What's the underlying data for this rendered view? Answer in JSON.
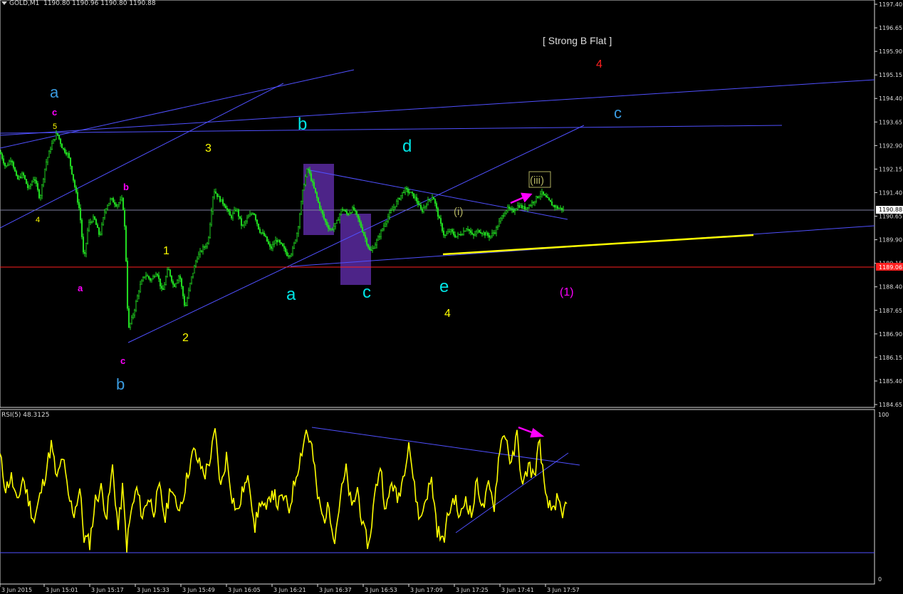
{
  "header": {
    "symbol": "GOLD,M1",
    "ohlc": "1190.80 1190.96 1190.80 1190.88"
  },
  "rsi_header": {
    "label": "RSI(5) 48.3125"
  },
  "colors": {
    "background": "#000000",
    "candle": "#22dd22",
    "trendline": "#5050ff",
    "red_line": "#ff2020",
    "yellow": "#ffff00",
    "cyan": "#00e5e5",
    "blue_label": "#3a9be0",
    "magenta": "#ff00ff",
    "purple_box": "#5a2aa0"
  },
  "chart_data": [
    {
      "type": "line",
      "name": "price",
      "title": "",
      "y_axis_ticks": [
        "1197.40",
        "1196.65",
        "1195.90",
        "1195.15",
        "1194.40",
        "1193.65",
        "1192.90",
        "1192.15",
        "1191.40",
        "1190.65",
        "1189.90",
        "1189.15",
        "1188.40",
        "1187.65",
        "1186.90",
        "1186.15",
        "1185.40",
        "1184.65"
      ],
      "ylim": [
        1184.65,
        1197.4
      ],
      "current_price": "1190.88",
      "red_level": "1189.06",
      "x_ticks": [
        "3 Jun 2015",
        "3 Jun 15:01",
        "3 Jun 15:17",
        "3 Jun 15:33",
        "3 Jun 15:49",
        "3 Jun 16:05",
        "3 Jun 16:21",
        "3 Jun 16:37",
        "3 Jun 16:53",
        "3 Jun 17:09",
        "3 Jun 17:25",
        "3 Jun 17:41",
        "3 Jun 17:57"
      ],
      "anchors": [
        [
          0,
          1192.7
        ],
        [
          8,
          1192.2
        ],
        [
          16,
          1192.5
        ],
        [
          24,
          1191.8
        ],
        [
          32,
          1192.0
        ],
        [
          40,
          1191.5
        ],
        [
          48,
          1191.9
        ],
        [
          56,
          1191.2
        ],
        [
          64,
          1192.3
        ],
        [
          72,
          1192.9
        ],
        [
          80,
          1193.3
        ],
        [
          88,
          1192.8
        ],
        [
          96,
          1192.6
        ],
        [
          104,
          1191.7
        ],
        [
          112,
          1190.8
        ],
        [
          118,
          1189.2
        ],
        [
          124,
          1190.4
        ],
        [
          132,
          1190.6
        ],
        [
          140,
          1190.0
        ],
        [
          148,
          1190.9
        ],
        [
          156,
          1191.2
        ],
        [
          164,
          1191.0
        ],
        [
          172,
          1191.2
        ],
        [
          176,
          1190.0
        ],
        [
          180,
          1187.0
        ],
        [
          188,
          1187.6
        ],
        [
          196,
          1188.4
        ],
        [
          204,
          1188.8
        ],
        [
          212,
          1188.6
        ],
        [
          220,
          1188.9
        ],
        [
          228,
          1188.2
        ],
        [
          236,
          1189.0
        ],
        [
          244,
          1188.4
        ],
        [
          252,
          1188.8
        ],
        [
          260,
          1187.7
        ],
        [
          268,
          1188.6
        ],
        [
          276,
          1189.3
        ],
        [
          284,
          1189.6
        ],
        [
          292,
          1189.8
        ],
        [
          300,
          1191.5
        ],
        [
          308,
          1191.2
        ],
        [
          316,
          1191.0
        ],
        [
          324,
          1190.6
        ],
        [
          332,
          1190.9
        ],
        [
          340,
          1190.3
        ],
        [
          348,
          1190.6
        ],
        [
          356,
          1190.8
        ],
        [
          364,
          1190.2
        ],
        [
          372,
          1190.0
        ],
        [
          380,
          1189.6
        ],
        [
          388,
          1189.9
        ],
        [
          396,
          1189.7
        ],
        [
          404,
          1189.4
        ],
        [
          410,
          1189.5
        ],
        [
          418,
          1190.2
        ],
        [
          426,
          1191.6
        ],
        [
          432,
          1192.2
        ],
        [
          440,
          1191.6
        ],
        [
          448,
          1191.0
        ],
        [
          456,
          1190.5
        ],
        [
          464,
          1190.2
        ],
        [
          472,
          1190.4
        ],
        [
          480,
          1190.9
        ],
        [
          488,
          1190.7
        ],
        [
          496,
          1190.9
        ],
        [
          504,
          1190.5
        ],
        [
          512,
          1190.0
        ],
        [
          520,
          1189.5
        ],
        [
          528,
          1189.8
        ],
        [
          536,
          1190.2
        ],
        [
          544,
          1190.6
        ],
        [
          552,
          1190.9
        ],
        [
          560,
          1191.2
        ],
        [
          568,
          1191.5
        ],
        [
          576,
          1191.4
        ],
        [
          584,
          1191.2
        ],
        [
          592,
          1190.8
        ],
        [
          600,
          1191.1
        ],
        [
          608,
          1191.3
        ],
        [
          616,
          1190.6
        ],
        [
          624,
          1190.0
        ],
        [
          632,
          1190.2
        ],
        [
          640,
          1190.0
        ],
        [
          648,
          1190.1
        ],
        [
          656,
          1190.3
        ],
        [
          664,
          1190.0
        ],
        [
          672,
          1190.2
        ],
        [
          680,
          1190.1
        ],
        [
          688,
          1190.0
        ],
        [
          696,
          1190.2
        ],
        [
          704,
          1190.6
        ],
        [
          712,
          1190.9
        ],
        [
          720,
          1190.8
        ],
        [
          728,
          1191.0
        ],
        [
          736,
          1190.9
        ],
        [
          744,
          1191.0
        ],
        [
          752,
          1191.2
        ],
        [
          760,
          1191.4
        ],
        [
          768,
          1191.2
        ],
        [
          776,
          1191.0
        ],
        [
          784,
          1190.9
        ],
        [
          792,
          1190.88
        ]
      ]
    },
    {
      "type": "line",
      "name": "RSI(5)",
      "title": "",
      "y_axis_ticks": [
        "100",
        "0"
      ],
      "ylim": [
        0,
        100
      ],
      "anchors": [
        [
          0,
          75
        ],
        [
          8,
          55
        ],
        [
          16,
          62
        ],
        [
          24,
          45
        ],
        [
          32,
          62
        ],
        [
          40,
          48
        ],
        [
          48,
          35
        ],
        [
          56,
          50
        ],
        [
          64,
          65
        ],
        [
          72,
          82
        ],
        [
          80,
          60
        ],
        [
          88,
          75
        ],
        [
          96,
          50
        ],
        [
          104,
          40
        ],
        [
          112,
          55
        ],
        [
          118,
          25
        ],
        [
          126,
          22
        ],
        [
          134,
          48
        ],
        [
          142,
          55
        ],
        [
          150,
          38
        ],
        [
          158,
          68
        ],
        [
          166,
          30
        ],
        [
          172,
          55
        ],
        [
          178,
          20
        ],
        [
          184,
          40
        ],
        [
          192,
          55
        ],
        [
          200,
          38
        ],
        [
          208,
          50
        ],
        [
          216,
          42
        ],
        [
          224,
          55
        ],
        [
          232,
          36
        ],
        [
          240,
          58
        ],
        [
          248,
          42
        ],
        [
          256,
          48
        ],
        [
          264,
          65
        ],
        [
          272,
          78
        ],
        [
          280,
          70
        ],
        [
          288,
          64
        ],
        [
          296,
          75
        ],
        [
          302,
          90
        ],
        [
          310,
          55
        ],
        [
          318,
          75
        ],
        [
          326,
          50
        ],
        [
          334,
          40
        ],
        [
          342,
          56
        ],
        [
          350,
          60
        ],
        [
          358,
          32
        ],
        [
          366,
          48
        ],
        [
          374,
          40
        ],
        [
          382,
          55
        ],
        [
          390,
          45
        ],
        [
          398,
          50
        ],
        [
          406,
          42
        ],
        [
          414,
          60
        ],
        [
          422,
          75
        ],
        [
          430,
          91
        ],
        [
          438,
          80
        ],
        [
          446,
          50
        ],
        [
          454,
          36
        ],
        [
          462,
          44
        ],
        [
          470,
          24
        ],
        [
          478,
          50
        ],
        [
          486,
          66
        ],
        [
          494,
          42
        ],
        [
          502,
          55
        ],
        [
          510,
          30
        ],
        [
          518,
          20
        ],
        [
          526,
          50
        ],
        [
          534,
          70
        ],
        [
          542,
          40
        ],
        [
          550,
          60
        ],
        [
          558,
          48
        ],
        [
          566,
          62
        ],
        [
          574,
          85
        ],
        [
          582,
          55
        ],
        [
          590,
          35
        ],
        [
          598,
          50
        ],
        [
          606,
          60
        ],
        [
          614,
          30
        ],
        [
          622,
          22
        ],
        [
          630,
          40
        ],
        [
          638,
          50
        ],
        [
          646,
          36
        ],
        [
          654,
          50
        ],
        [
          662,
          38
        ],
        [
          670,
          60
        ],
        [
          678,
          42
        ],
        [
          686,
          56
        ],
        [
          694,
          45
        ],
        [
          702,
          82
        ],
        [
          710,
          89
        ],
        [
          718,
          68
        ],
        [
          726,
          88
        ],
        [
          734,
          55
        ],
        [
          742,
          70
        ],
        [
          750,
          62
        ],
        [
          758,
          85
        ],
        [
          766,
          48
        ],
        [
          774,
          42
        ],
        [
          782,
          48
        ],
        [
          790,
          36
        ],
        [
          796,
          50
        ]
      ]
    }
  ],
  "annotations": {
    "strong_b_flat": "[ Strong B Flat ]",
    "red_4": "4",
    "blue_a_left": "a",
    "blue_b_left": "b",
    "blue_c_right": "c",
    "mag_c_top": "c",
    "yel_5_top": "5",
    "yel_4_left": "4",
    "mag_b_mid": "b",
    "mag_a_low": "a",
    "mag_c_low": "c",
    "yel_3": "3",
    "yel_1": "1",
    "yel_2": "2",
    "cyan_b": "b",
    "cyan_a": "a",
    "cyan_c": "c",
    "cyan_d": "d",
    "cyan_e": "e",
    "yel_4_low": "4",
    "ol_i": "(i)",
    "ol_iii": "(iii)",
    "mag_1": "(1)"
  }
}
